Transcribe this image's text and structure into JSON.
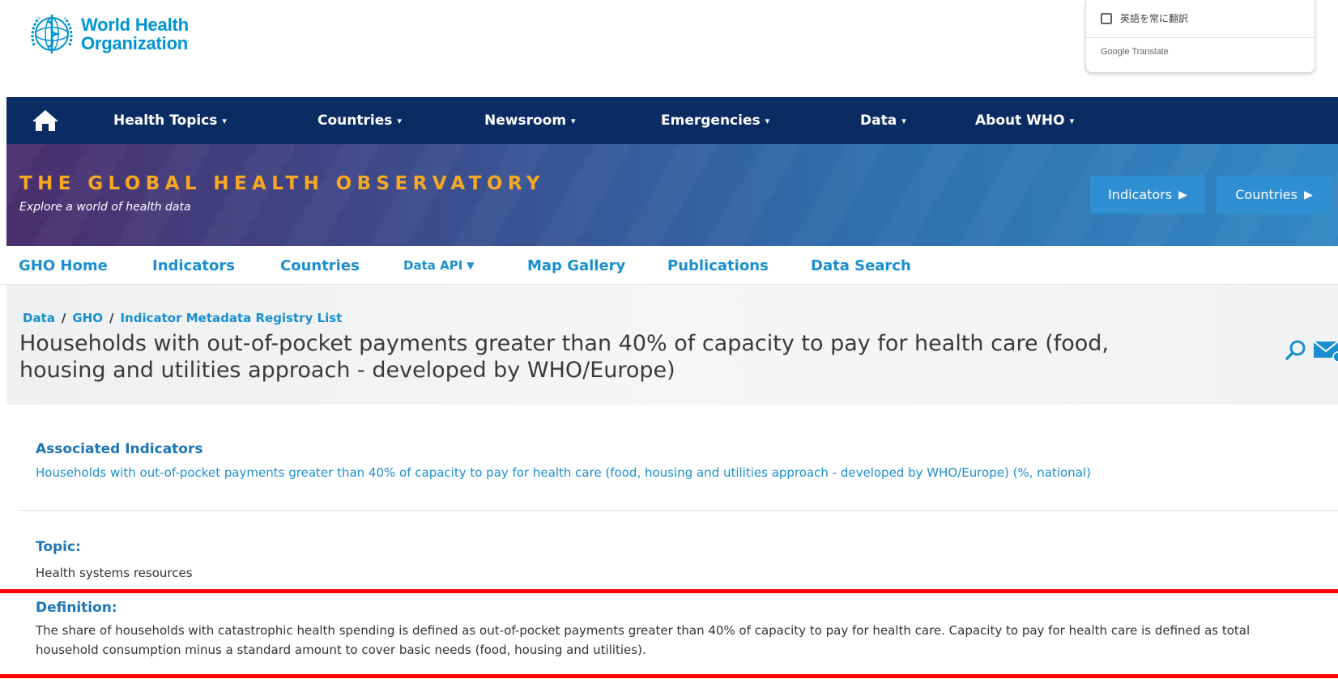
{
  "who_logo": {
    "line1": "World Health",
    "line2": "Organization"
  },
  "translate_popup": {
    "checkbox_label": "英語を常に翻訳",
    "brand": "Google Translate"
  },
  "main_nav": {
    "items": [
      {
        "label": "Health Topics"
      },
      {
        "label": "Countries"
      },
      {
        "label": "Newsroom"
      },
      {
        "label": "Emergencies"
      },
      {
        "label": "Data"
      },
      {
        "label": "About WHO"
      }
    ],
    "chevron": "⌄"
  },
  "banner": {
    "title": "THE GLOBAL HEALTH OBSERVATORY",
    "subtitle": "Explore a world of health data",
    "buttons": [
      {
        "label": "Indicators"
      },
      {
        "label": "Countries"
      }
    ]
  },
  "sub_nav": {
    "items": [
      {
        "label": "GHO Home"
      },
      {
        "label": "Indicators"
      },
      {
        "label": "Countries"
      },
      {
        "label": "Data API"
      },
      {
        "label": "Map Gallery"
      },
      {
        "label": "Publications"
      },
      {
        "label": "Data Search"
      }
    ]
  },
  "breadcrumb": {
    "items": [
      "Data",
      "GHO",
      "Indicator Metadata Registry List"
    ],
    "separator": "/"
  },
  "page_title": "Households with out-of-pocket payments greater than 40% of capacity to pay for health care (food, housing and utilities approach - developed by WHO/Europe)",
  "content": {
    "associated": {
      "label": "Associated Indicators",
      "link": "Households with out-of-pocket payments greater than 40% of capacity to pay for health care (food, housing and utilities approach - developed by WHO/Europe) (%, national)"
    },
    "topic": {
      "label": "Topic:",
      "value": "Health systems resources"
    },
    "definition": {
      "label": "Definition:",
      "line1": "The share of households with catastrophic health spending is defined as out-of-pocket payments greater than 40% of capacity to pay for health care. Capacity to pay for health care is defined as total",
      "line2": "household consumption minus a standard amount to cover basic needs (food, housing and utilities)."
    }
  },
  "colors": {
    "nav_bg": "#0b2c63",
    "banner_title": "#f7a823",
    "link_blue": "#1a8fd0",
    "highlight": "#ff0000"
  }
}
